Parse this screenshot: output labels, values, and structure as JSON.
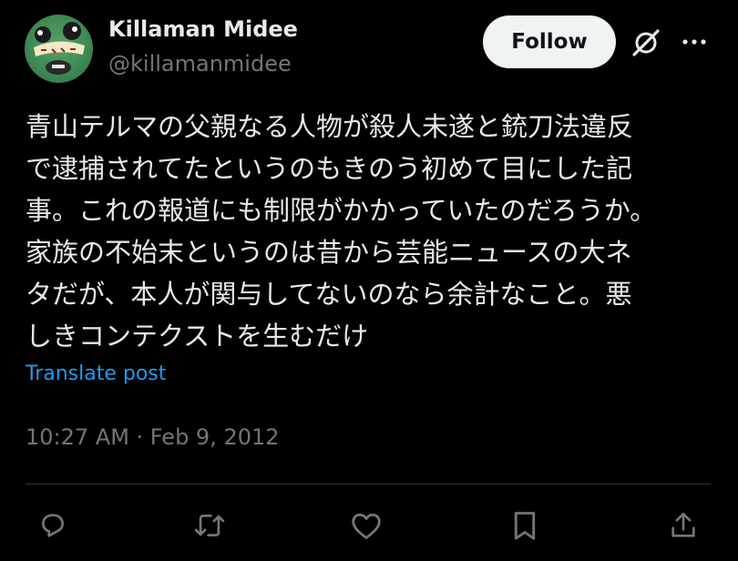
{
  "author": {
    "display_name": "Killaman Midee",
    "handle": "@killamanmidee",
    "avatar_icon": "character-artwork-avatar"
  },
  "header": {
    "follow_label": "Follow",
    "grok_icon": "grok-icon",
    "more_icon": "more-dots-icon"
  },
  "post": {
    "text_lines": [
      "青山テルマの父親なる人物が殺人未遂と銃刀法違反",
      "で逮捕されてたというのもきのう初めて目にした記",
      "事。これの報道にも制限がかかっていたのだろうか。",
      "家族の不始末というのは昔から芸能ニュースの大ネ",
      "タだが、本人が関与してないのなら余計なこと。悪",
      "しきコンテクストを生むだけ"
    ],
    "translate_label": "Translate post",
    "timestamp": "10:27 AM · Feb 9, 2012"
  },
  "actions": {
    "icons": [
      "reply-icon",
      "repost-icon",
      "like-icon",
      "bookmark-icon",
      "share-icon"
    ]
  },
  "colors": {
    "background": "#000000",
    "text": "#e7e9ea",
    "secondary": "#71767b",
    "link": "#1d9bf0",
    "follow_bg": "#eff3f4",
    "divider": "#2f3336"
  }
}
